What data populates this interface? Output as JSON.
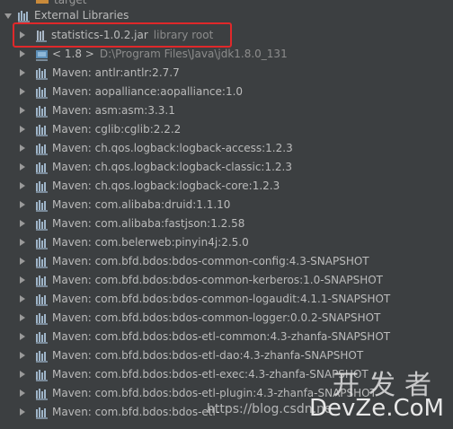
{
  "tree": {
    "top_partial_label": "target",
    "root": {
      "label": "External Libraries"
    },
    "selected": {
      "label": "statistics-1.0.2.jar",
      "secondary": "library root"
    },
    "jdk": {
      "label": "< 1.8 >",
      "secondary": "D:\\Program Files\\Java\\jdk1.8.0_131"
    },
    "maven_items": [
      "Maven: antlr:antlr:2.7.7",
      "Maven: aopalliance:aopalliance:1.0",
      "Maven: asm:asm:3.3.1",
      "Maven: cglib:cglib:2.2.2",
      "Maven: ch.qos.logback:logback-access:1.2.3",
      "Maven: ch.qos.logback:logback-classic:1.2.3",
      "Maven: ch.qos.logback:logback-core:1.2.3",
      "Maven: com.alibaba:druid:1.1.10",
      "Maven: com.alibaba:fastjson:1.2.58",
      "Maven: com.belerweb:pinyin4j:2.5.0",
      "Maven: com.bfd.bdos:bdos-common-config:4.3-SNAPSHOT",
      "Maven: com.bfd.bdos:bdos-common-kerberos:1.0-SNAPSHOT",
      "Maven: com.bfd.bdos:bdos-common-logaudit:4.1.1-SNAPSHOT",
      "Maven: com.bfd.bdos:bdos-common-logger:0.0.2-SNAPSHOT",
      "Maven: com.bfd.bdos:bdos-etl-common:4.3-zhanfa-SNAPSHOT",
      "Maven: com.bfd.bdos:bdos-etl-dao:4.3-zhanfa-SNAPSHOT",
      "Maven: com.bfd.bdos:bdos-etl-exec:4.3-zhanfa-SNAPSHOT",
      "Maven: com.bfd.bdos:bdos-etl-plugin:4.3-zhanfa-SNAPSHOT",
      "Maven: com.bfd.bdos:bdos-etl-"
    ]
  },
  "watermark": {
    "chinese": "开发者",
    "english": "DevZe.CoM",
    "url": "https://blog.csdn.ne"
  },
  "colors": {
    "background": "#3c3f41",
    "text": "#bbbbbb",
    "secondary_text": "#8c8c8c",
    "highlight_border": "#e0282a"
  }
}
